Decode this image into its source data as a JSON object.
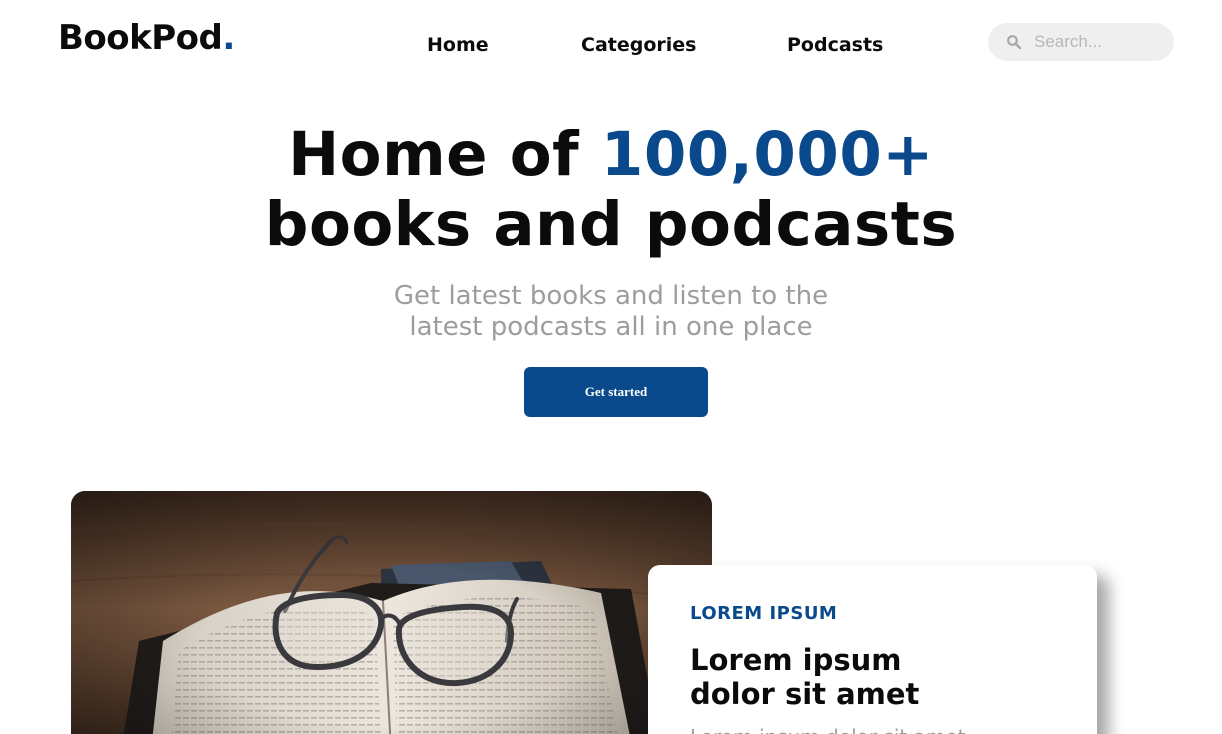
{
  "header": {
    "logo_text": "BookPod",
    "logo_dot": ".",
    "nav": [
      {
        "label": "Home"
      },
      {
        "label": "Categories"
      },
      {
        "label": "Podcasts"
      }
    ],
    "search": {
      "placeholder": "Search...",
      "icon": "search-icon"
    }
  },
  "hero": {
    "title_prefix": "Home of ",
    "title_accent": "100,000+",
    "title_line2": "books and podcasts",
    "subtitle_line1": "Get latest books and listen to the",
    "subtitle_line2": "latest podcasts all in one place",
    "cta_label": "Get started"
  },
  "feature": {
    "image": "open-book-with-glasses",
    "eyebrow": "LOREM IPSUM",
    "title_line1": "Lorem ipsum",
    "title_line2": "dolor sit amet",
    "body": "Lorem ipsum dolor sit amet"
  },
  "colors": {
    "brand": "#0a4a8c",
    "muted_text": "#9d9d9d",
    "search_bg": "#efefef"
  }
}
